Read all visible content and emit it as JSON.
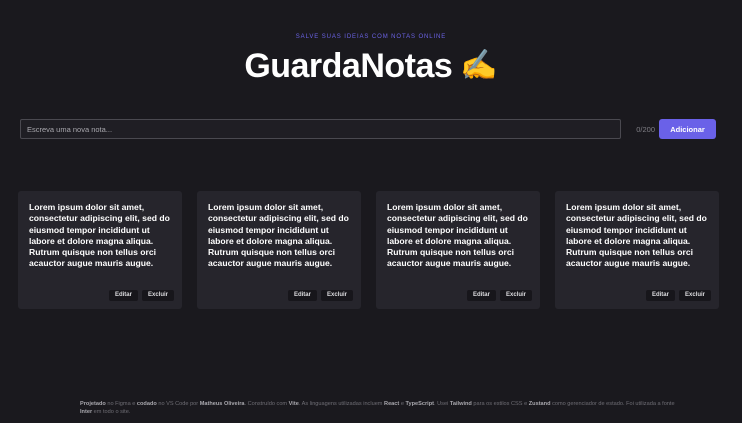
{
  "header": {
    "eyebrow": "SALVE SUAS IDEIAS COM NOTAS ONLINE",
    "title": "GuardaNotas",
    "title_icon": "writing-hand-emoji"
  },
  "composer": {
    "placeholder": "Escreva uma nova nota...",
    "value": "",
    "char_count": "0/200",
    "add_label": "Adicionar"
  },
  "notes": [
    {
      "text": "Lorem ipsum dolor sit amet, consectetur adipiscing elit, sed do eiusmod tempor incididunt ut labore et dolore magna aliqua. Rutrum quisque non tellus orci acauctor augue mauris augue.",
      "edit_label": "Editar",
      "delete_label": "Excluir"
    },
    {
      "text": "Lorem ipsum dolor sit amet, consectetur adipiscing elit, sed do eiusmod tempor incididunt ut labore et dolore magna aliqua. Rutrum quisque non tellus orci acauctor augue mauris augue.",
      "edit_label": "Editar",
      "delete_label": "Excluir"
    },
    {
      "text": "Lorem ipsum dolor sit amet, consectetur adipiscing elit, sed do eiusmod tempor incididunt ut labore et dolore magna aliqua. Rutrum quisque non tellus orci acauctor augue mauris augue.",
      "edit_label": "Editar",
      "delete_label": "Excluir"
    },
    {
      "text": "Lorem ipsum dolor sit amet, consectetur adipiscing elit, sed do eiusmod tempor incididunt ut labore et dolore magna aliqua. Rutrum quisque non tellus orci acauctor augue mauris augue.",
      "edit_label": "Editar",
      "delete_label": "Excluir"
    }
  ],
  "footer": {
    "parts": [
      {
        "text": "Projetado",
        "bold": true
      },
      {
        "text": " no Figma e ",
        "bold": false
      },
      {
        "text": "codado",
        "bold": true
      },
      {
        "text": " no VS Code por ",
        "bold": false
      },
      {
        "text": "Matheus Oliveira",
        "bold": true
      },
      {
        "text": ". Construído com ",
        "bold": false
      },
      {
        "text": "Vite",
        "bold": true
      },
      {
        "text": ". As linguagens utilizadas incluem ",
        "bold": false
      },
      {
        "text": "React",
        "bold": true
      },
      {
        "text": " e ",
        "bold": false
      },
      {
        "text": "TypeScript",
        "bold": true
      },
      {
        "text": ". Usei ",
        "bold": false
      },
      {
        "text": "Tailwind",
        "bold": true
      },
      {
        "text": " para os estilos CSS e ",
        "bold": false
      },
      {
        "text": "Zustand",
        "bold": true
      },
      {
        "text": " como gerenciador de estado. Foi utilizada a fonte ",
        "bold": false
      },
      {
        "text": "Inter",
        "bold": true
      },
      {
        "text": " em todo o site.",
        "bold": false
      }
    ]
  },
  "colors": {
    "background": "#1a191e",
    "card": "#26252c",
    "accent": "#6a61e8"
  }
}
